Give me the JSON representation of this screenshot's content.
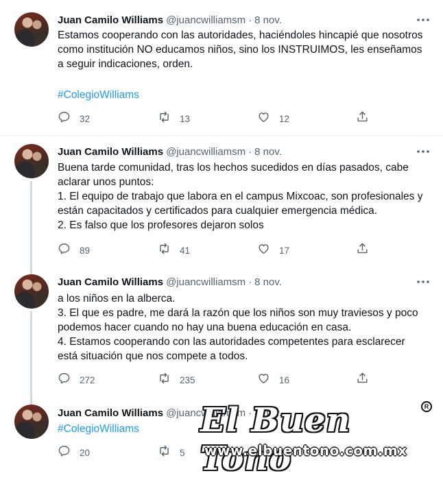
{
  "author": {
    "name": "Juan Camilo Williams",
    "handle": "@juancwilliamsm",
    "separator": "·"
  },
  "tweets": [
    {
      "date": "8 nov.",
      "text": "Estamos cooperando con las autoridades, haciéndoles hincapié que nosotros como institución NO educamos niños, sino los INSTRUIMOS, les enseñamos a seguir indicaciones, orden.",
      "hashtag": "#ColegioWilliams",
      "replies": "32",
      "retweets": "13",
      "likes": "12"
    },
    {
      "date": "8 nov.",
      "text": "Buena tarde comunidad, tras los hechos sucedidos en días pasados, cabe aclarar unos puntos:\n1. El equipo de trabajo que labora en el campus Mixcoac, son profesionales y están capacitados y certificados para cualquier emergencia médica.\n2. Es falso que los profesores dejaron solos",
      "replies": "89",
      "retweets": "41",
      "likes": "17"
    },
    {
      "date": "8 nov.",
      "text": "a los niños en la alberca.\n3. El que es padre, me dará la razón que los niños son muy traviesos y poco podemos hacer cuando no hay una buena educación en casa.\n4. Estamos cooperando con las autoridades competentes para esclarecer está situación que nos compete a todos.",
      "replies": "272",
      "retweets": "235",
      "likes": "16"
    },
    {
      "date": "8 nov.",
      "hashtag": "#ColegioWilliams",
      "replies": "20",
      "retweets": "5"
    }
  ],
  "watermark": {
    "logo": "El Buen Tono",
    "registered": "R",
    "url": "www.elbuentono.com.mx"
  },
  "icons": {
    "reply": "reply-icon",
    "retweet": "retweet-icon",
    "like": "like-icon",
    "share": "share-icon",
    "more": "more-icon"
  },
  "colors": {
    "accent": "#1d9bf0",
    "text": "#0f1419",
    "muted": "#536471",
    "thread_line": "#cfd9de"
  }
}
